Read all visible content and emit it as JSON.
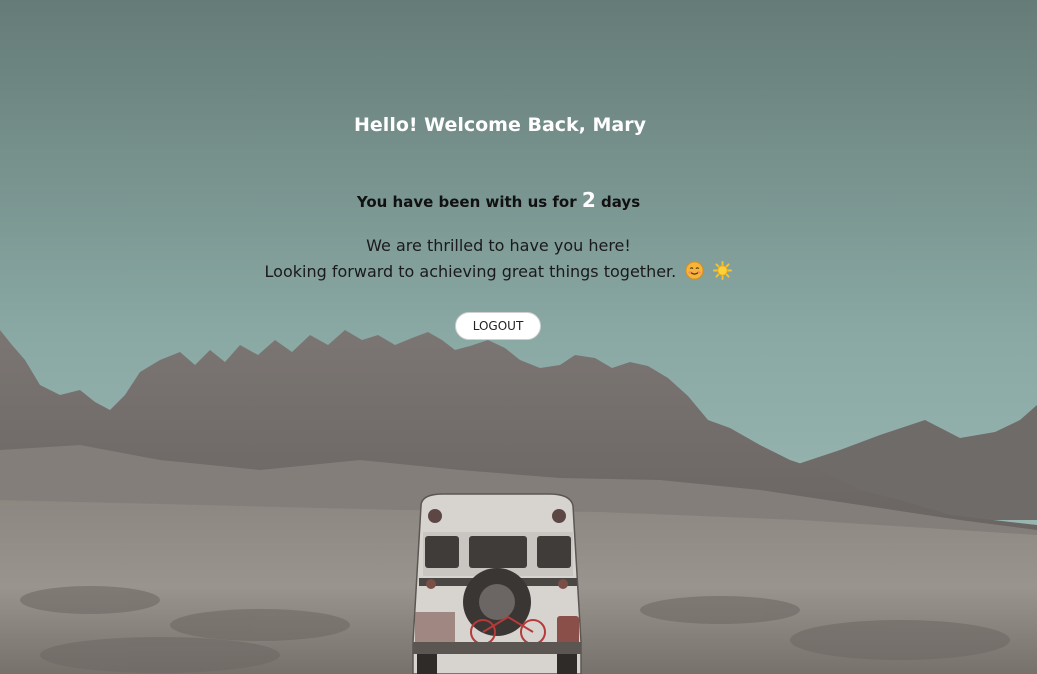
{
  "welcome": {
    "greeting": "Hello! Welcome Back, Mary"
  },
  "tenure": {
    "prefix": "You have been with us for",
    "count": "2",
    "suffix": "days"
  },
  "message": {
    "line1": "We are thrilled to have you here!",
    "line2": "Looking forward to achieving great things together.",
    "emojis": [
      "smiling-face-icon",
      "sun-icon"
    ]
  },
  "actions": {
    "logout_label": "LOGOUT"
  },
  "background": {
    "description_icon": "mountain-desert-bus-photo"
  }
}
